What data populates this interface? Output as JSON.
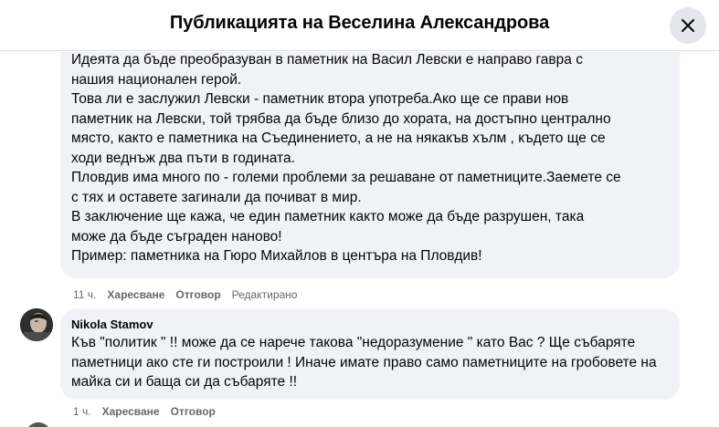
{
  "header": {
    "title": "Публикацията на Веселина Александрова",
    "close_icon": "close-icon"
  },
  "comment_1": {
    "text": "Идеята да бъде преобразуван в паметник на Васил Левски е направо гавра с\nнашия национален герой.\nТова ли е заслужил Левски - паметник втора употреба.Ако ще се прави нов\nпаметник на Левски, той трябва да бъде близо до хората, на достъпно централно\nмясто, както е паметника на Съединението, а не на някакъв хълм , където ще се\nходи веднъж два пъти в годината.\nПловдив има много по - големи проблеми за решаване от паметниците.Заемете се\nс тях и оставете загинали да почиват в мир.\nВ заключение ще кажа, че един паметник както може да бъде разрушен, така\nможе да бъде съграден наново!\nПример: паметника на Гюро Михайлов в центъра на Пловдив!",
    "time": "11 ч.",
    "like_label": "Харесване",
    "reply_label": "Отговор",
    "edited_label": "Редактирано"
  },
  "comment_2": {
    "author": "Nikola Stamov",
    "text": "Къв \"политик \" !! може да се нарече такова \"недоразумение \" като Вас ? Ще събаряте паметници ако сте ги построили ! Иначе имате право само паметниците на гробовете на майка си и баща си да събаряте !!",
    "time": "1 ч.",
    "like_label": "Харесване",
    "reply_label": "Отговор"
  }
}
